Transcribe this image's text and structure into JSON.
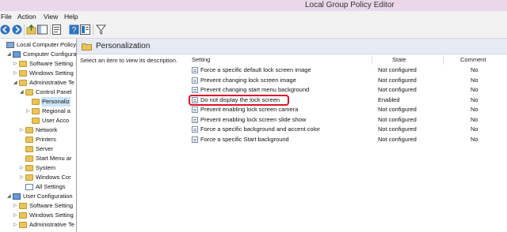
{
  "window": {
    "title": "Local Group Policy Editor"
  },
  "menu": [
    "File",
    "Action",
    "View",
    "Help"
  ],
  "toolbar": {
    "icons": [
      "back-icon",
      "forward-icon",
      "up-folder-icon",
      "show-hide-tree-icon",
      "properties-icon",
      "help-icon",
      "extended-view-icon",
      "filter-icon"
    ]
  },
  "tree": [
    {
      "label": "Local Computer Policy",
      "level": 0,
      "expander": "",
      "icon": "computer-policy-icon"
    },
    {
      "label": "Computer Configura",
      "level": 1,
      "expander": "open",
      "icon": "computer-icon"
    },
    {
      "label": "Software Setting",
      "level": 2,
      "expander": "closed",
      "icon": "folder-icon"
    },
    {
      "label": "Windows Setting",
      "level": 2,
      "expander": "closed",
      "icon": "folder-icon"
    },
    {
      "label": "Administrative Te",
      "level": 2,
      "expander": "open",
      "icon": "folder-icon"
    },
    {
      "label": "Control Panel",
      "level": 3,
      "expander": "open",
      "icon": "folder-icon"
    },
    {
      "label": "Personaliz",
      "level": 4,
      "expander": "",
      "icon": "folder-icon",
      "selected": true
    },
    {
      "label": "Regional a",
      "level": 4,
      "expander": "closed",
      "icon": "folder-icon"
    },
    {
      "label": "User Acco",
      "level": 4,
      "expander": "",
      "icon": "folder-icon"
    },
    {
      "label": "Network",
      "level": 3,
      "expander": "closed",
      "icon": "folder-icon"
    },
    {
      "label": "Printers",
      "level": 3,
      "expander": "",
      "icon": "folder-icon"
    },
    {
      "label": "Server",
      "level": 3,
      "expander": "",
      "icon": "folder-icon"
    },
    {
      "label": "Start Menu ar",
      "level": 3,
      "expander": "",
      "icon": "folder-icon"
    },
    {
      "label": "System",
      "level": 3,
      "expander": "closed",
      "icon": "folder-icon"
    },
    {
      "label": "Windows Cor",
      "level": 3,
      "expander": "closed",
      "icon": "folder-icon"
    },
    {
      "label": "All Settings",
      "level": 3,
      "expander": "",
      "icon": "settings-icon"
    },
    {
      "label": "User Configuration",
      "level": 1,
      "expander": "open",
      "icon": "user-icon"
    },
    {
      "label": "Software Setting",
      "level": 2,
      "expander": "closed",
      "icon": "folder-icon"
    },
    {
      "label": "Windows Setting",
      "level": 2,
      "expander": "closed",
      "icon": "folder-icon"
    },
    {
      "label": "Administrative Te",
      "level": 2,
      "expander": "closed",
      "icon": "folder-icon"
    }
  ],
  "panel": {
    "header": "Personalization",
    "description": "Select an item to view its description.",
    "columns": {
      "setting": "Setting",
      "state": "State",
      "comment": "Comment"
    },
    "rows": [
      {
        "setting": "Force a specific default lock screen image",
        "state": "Not configured",
        "comment": "No"
      },
      {
        "setting": "Prevent changing lock screen image",
        "state": "Not configured",
        "comment": "No"
      },
      {
        "setting": "Prevent changing start menu background",
        "state": "Not configured",
        "comment": "No"
      },
      {
        "setting": "Do not display the lock screen",
        "state": "Enabled",
        "comment": "No",
        "highlighted": true
      },
      {
        "setting": "Prevent enabling lock screen camera",
        "state": "Not configured",
        "comment": "No"
      },
      {
        "setting": "Prevent enabling lock screen slide show",
        "state": "Not configured",
        "comment": "No"
      },
      {
        "setting": "Force a specific background and accent color",
        "state": "Not configured",
        "comment": "No"
      },
      {
        "setting": "Force a specific Start background",
        "state": "Not configured",
        "comment": "No"
      }
    ]
  },
  "colors": {
    "titlebar": "#ead8ea",
    "header": "#e6eaf3",
    "selection": "#cce4f7",
    "highlight_ring": "#d9152b",
    "folder": "#e8c45a"
  }
}
